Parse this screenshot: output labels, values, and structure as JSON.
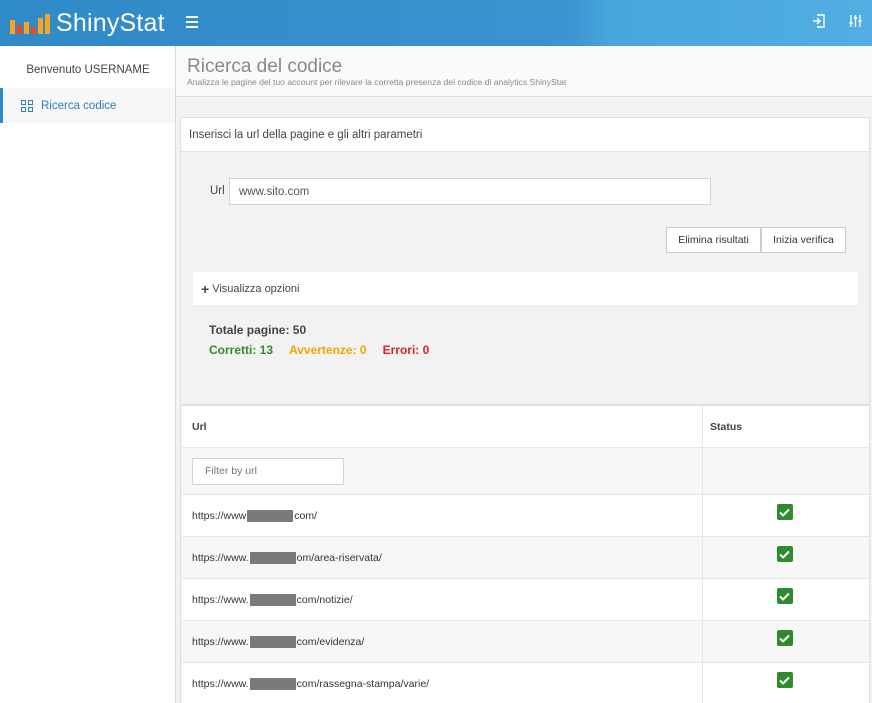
{
  "header": {
    "logo_text": "ShinyStat",
    "logo_bar_colors": [
      "#f6a623",
      "#e8491d",
      "#f6a623",
      "#e8491d",
      "#f6a623",
      "#f6a623"
    ],
    "icons": [
      "hamburger-menu-icon",
      "logout-icon",
      "settings-sliders-icon"
    ]
  },
  "sidebar": {
    "welcome": "Benvenuto USERNAME",
    "items": [
      {
        "label": "Ricerca codice",
        "icon": "grid-icon",
        "active": true
      }
    ]
  },
  "page": {
    "title": "Ricerca del codice",
    "subtitle": "Analizza le pagine del tuo account per rilevare la corretta presenza del codice di analytics ShinyStat"
  },
  "form": {
    "panel_title": "Inserisci la url della pagine e gli altri parametri",
    "url_label": "Url",
    "url_value": "www.sito.com",
    "delete_label": "Elimina risultati",
    "start_label": "Inizia verifica",
    "options_label": "Visualizza opzioni"
  },
  "summary": {
    "total": "Totale pagine: 50",
    "ok": "Corretti: 13",
    "warnings": "Avvertenze: 0",
    "errors": "Errori: 0",
    "colors": {
      "ok": "#2e8b2e",
      "warnings": "#f0a400",
      "errors": "#dd2222"
    }
  },
  "table": {
    "col_url": "Url",
    "col_status": "Status",
    "filter_placeholder": "Filter by url",
    "rows": [
      {
        "prefix": "https://www",
        "suffix": "com/",
        "status": "ok"
      },
      {
        "prefix": "https://www.",
        "suffix": "om/area-riservata/",
        "status": "ok"
      },
      {
        "prefix": "https://www.",
        "suffix": "com/notizie/",
        "status": "ok"
      },
      {
        "prefix": "https://www.",
        "suffix": "com/evidenza/",
        "status": "ok"
      },
      {
        "prefix": "https://www.",
        "suffix": "com/rassegna-stampa/varie/",
        "status": "ok"
      }
    ]
  }
}
